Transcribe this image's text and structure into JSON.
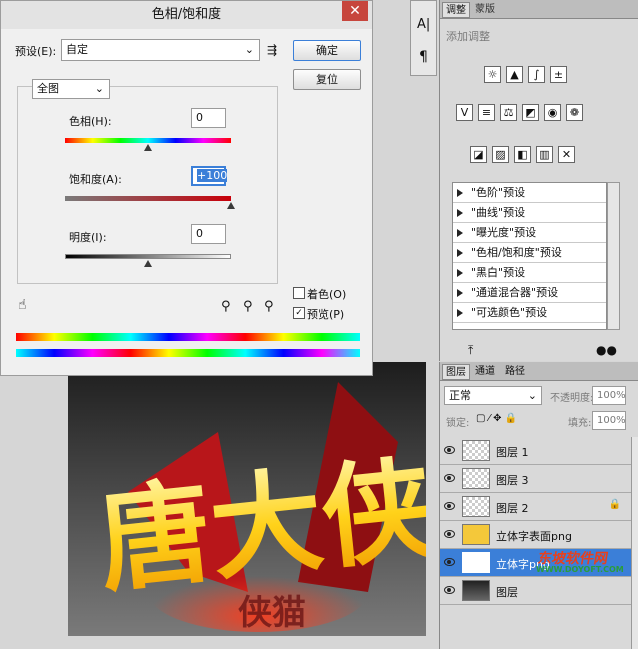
{
  "dialog": {
    "title": "色相/饱和度",
    "close_glyph": "✕",
    "preset_label": "预设(E):",
    "preset_value": "自定",
    "ok_label": "确定",
    "reset_label": "复位",
    "channel_value": "全图",
    "hue": {
      "label": "色相(H):",
      "value": "0",
      "level": 0.5
    },
    "saturation": {
      "label": "饱和度(A):",
      "value": "+100",
      "level": 1.0
    },
    "lightness": {
      "label": "明度(I):",
      "value": "0",
      "level": 0.5
    },
    "colorize_label": "着色(O)",
    "colorize_checked": false,
    "preview_label": "预览(P)",
    "preview_checked": true,
    "check_glyph": "✓"
  },
  "tools_bar": {
    "char_glyph": "A|",
    "para_glyph": "¶"
  },
  "adjustments": {
    "tabs": [
      "调整",
      "蒙版"
    ],
    "subtitle": "添加调整",
    "presets": [
      "\"色阶\"预设",
      "\"曲线\"预设",
      "\"曝光度\"预设",
      "\"色相/饱和度\"预设",
      "\"黑白\"预设",
      "\"通道混合器\"预设",
      "\"可选颜色\"预设"
    ]
  },
  "layers": {
    "tabs": [
      "图层",
      "通道",
      "路径"
    ],
    "blend_mode": "正常",
    "opacity_label": "不透明度:",
    "opacity_value": "100%",
    "lock_label": "锁定:",
    "fill_label": "填充:",
    "fill_value": "100%",
    "items": [
      {
        "name": "图层 1",
        "selected": false
      },
      {
        "name": "图层 3",
        "selected": false
      },
      {
        "name": "图层 2",
        "selected": false,
        "locked": true
      },
      {
        "name": "立体字表面png",
        "selected": false
      },
      {
        "name": "立体字png",
        "selected": true
      },
      {
        "name": "图层",
        "selected": false
      }
    ]
  },
  "watermark": {
    "line1": "东坡软件网",
    "line2": "WWW.DOYOFT.COM"
  },
  "canvas_art": {
    "main_text": "唐大侠",
    "reflection": "侠猫"
  },
  "colors": {
    "accent": "#3b7fd8",
    "close_red": "#c7463d",
    "art_gold": "#ffd21a",
    "art_red": "#b8161a"
  }
}
